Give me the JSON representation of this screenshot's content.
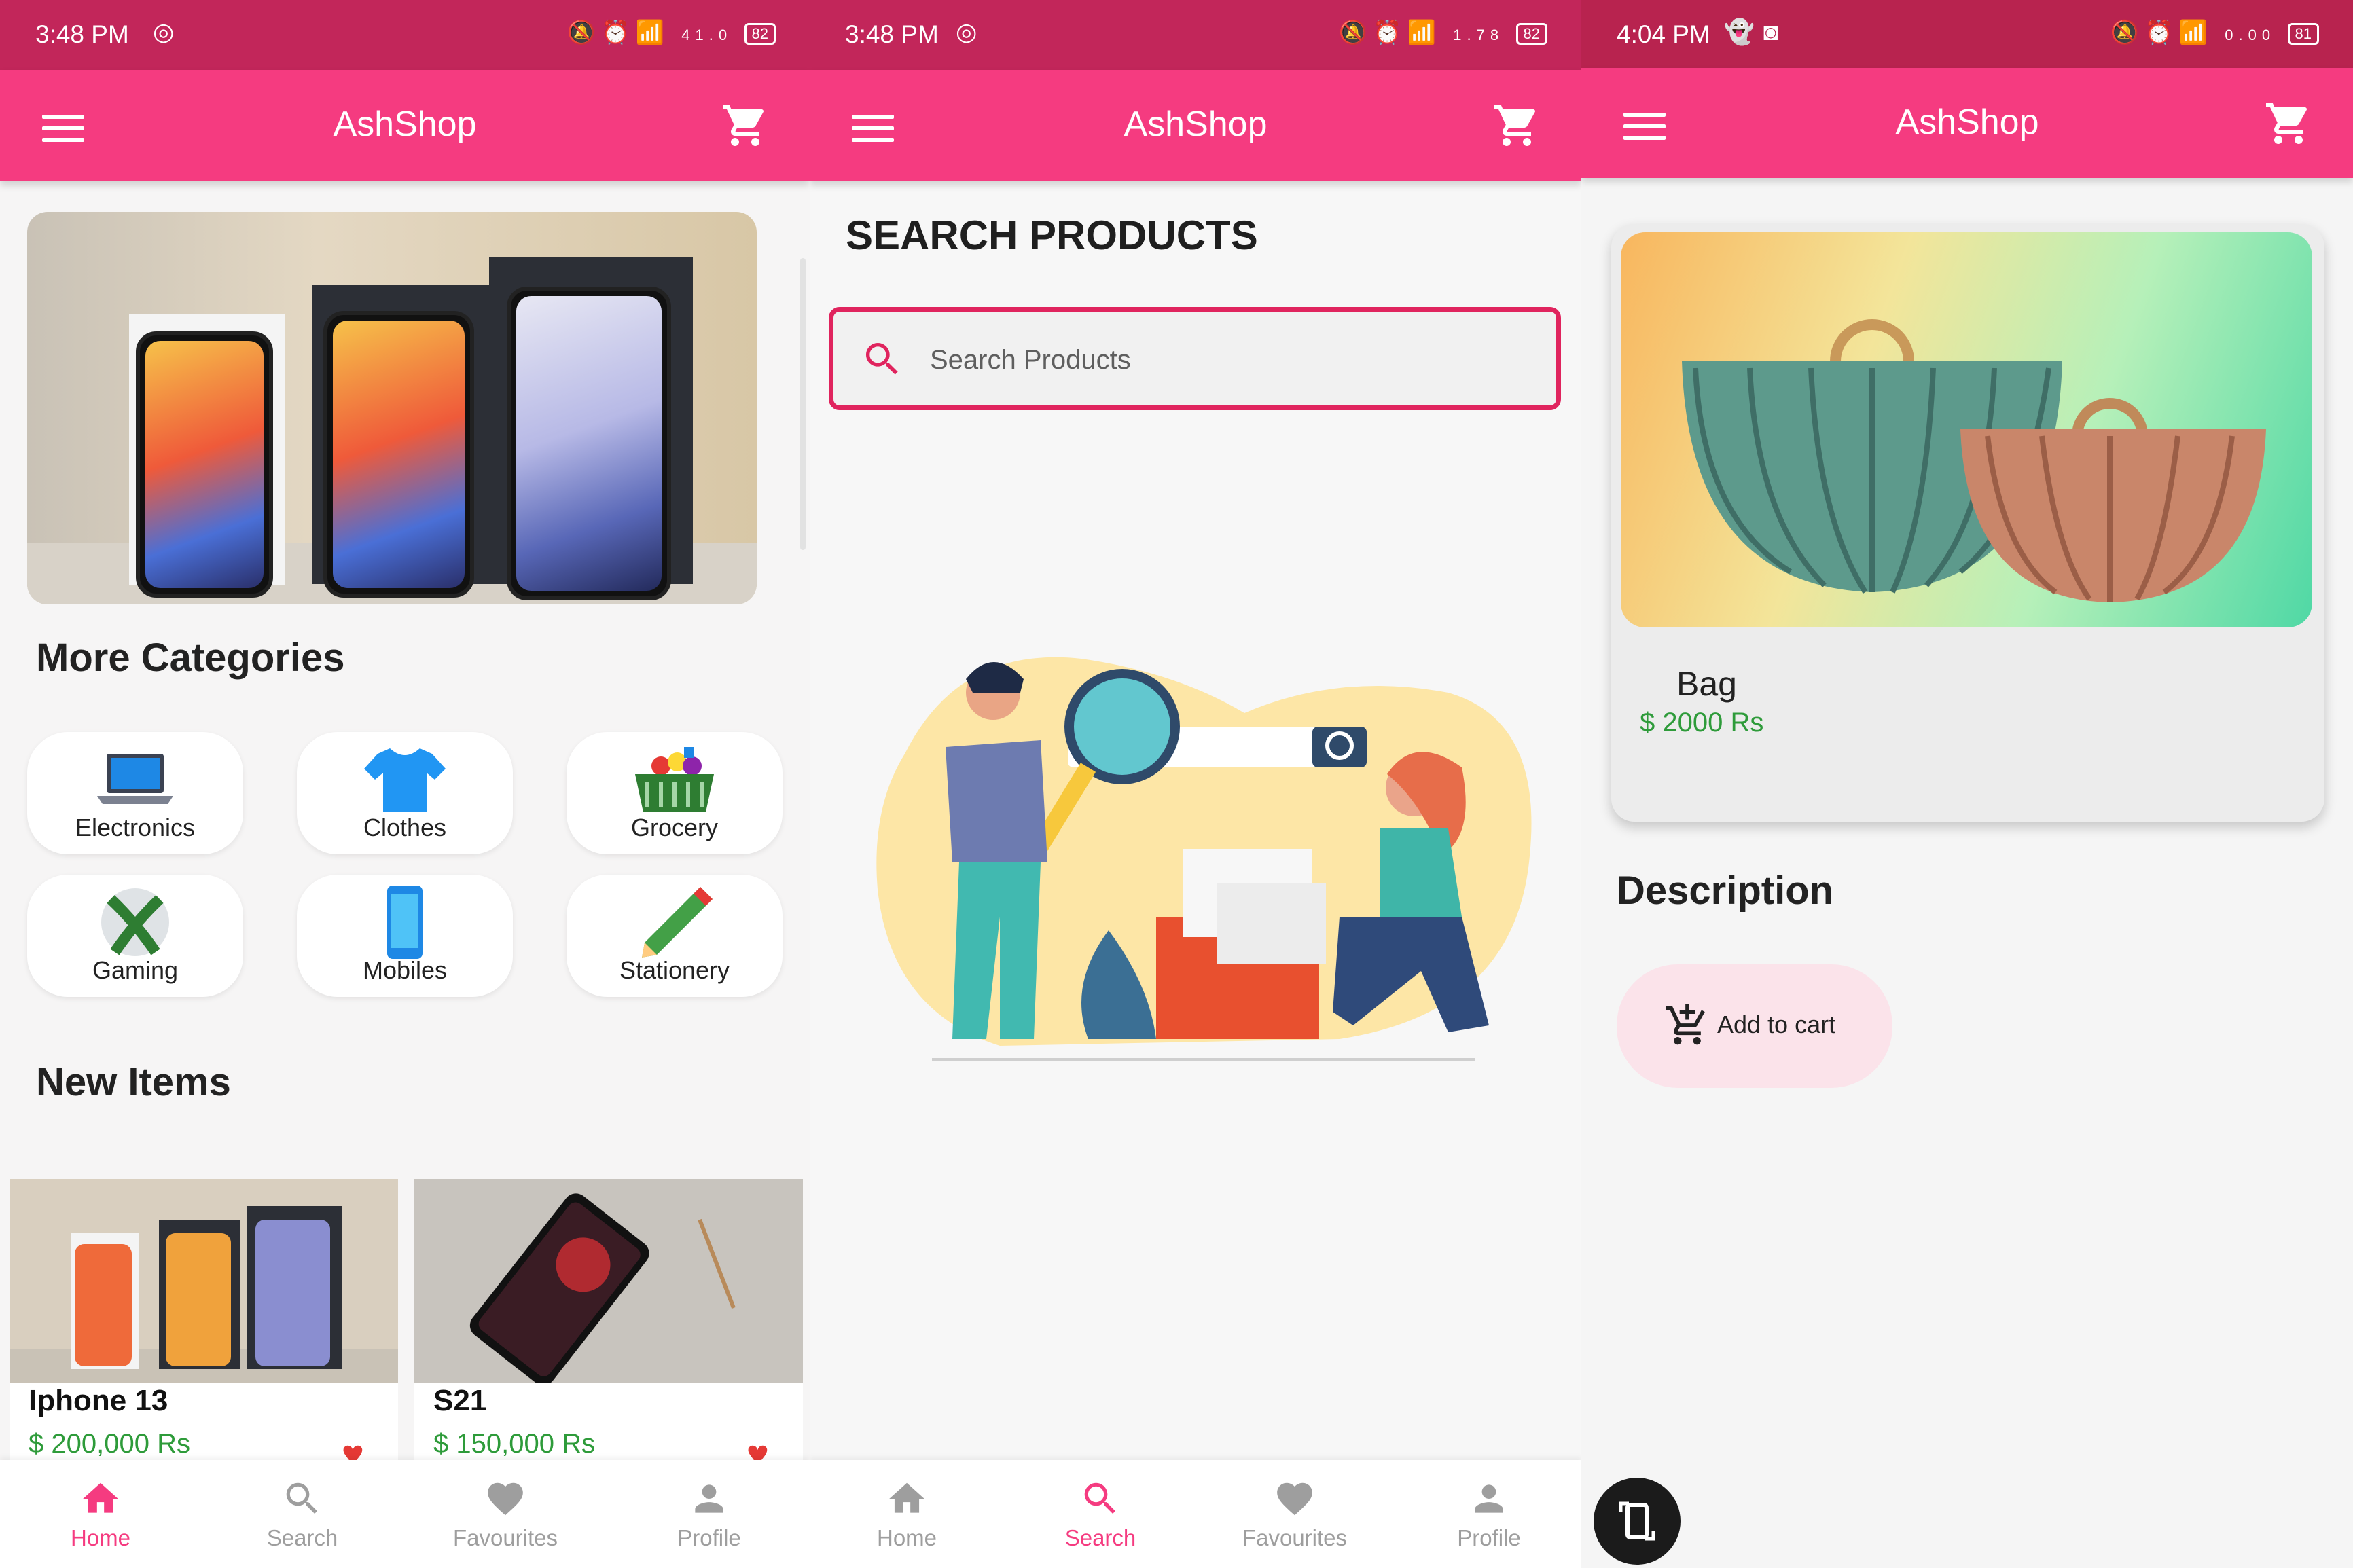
{
  "screens": [
    {
      "status": {
        "time": "3:48 PM",
        "net": "41.0",
        "battery": "82"
      },
      "app_title": "AshShop",
      "categories_heading": "More Categories",
      "categories": [
        {
          "label": "Electronics",
          "icon": "laptop-icon"
        },
        {
          "label": "Clothes",
          "icon": "tshirt-icon"
        },
        {
          "label": "Grocery",
          "icon": "basket-icon"
        },
        {
          "label": "Gaming",
          "icon": "xbox-icon"
        },
        {
          "label": "Mobiles",
          "icon": "phone-icon"
        },
        {
          "label": "Stationery",
          "icon": "pencil-icon"
        }
      ],
      "new_items_heading": "New Items",
      "products": [
        {
          "name": "Iphone 13",
          "price": "200,000 Rs"
        },
        {
          "name": "S21",
          "price": "150,000 Rs"
        }
      ],
      "nav": [
        "Home",
        "Search",
        "Favourites",
        "Profile"
      ],
      "active_nav": "Home"
    },
    {
      "status": {
        "time": "3:48 PM",
        "net": "1.78",
        "battery": "82"
      },
      "app_title": "AshShop",
      "heading": "SEARCH PRODUCTS",
      "search_placeholder": "Search Products",
      "nav": [
        "Home",
        "Search",
        "Favourites",
        "Profile"
      ],
      "active_nav": "Search"
    },
    {
      "status": {
        "time": "4:04 PM",
        "net": "0.00",
        "battery": "81"
      },
      "app_title": "AshShop",
      "product": {
        "name": "Bag",
        "price": "2000 Rs"
      },
      "description_heading": "Description",
      "add_to_cart_label": "Add to cart"
    }
  ],
  "colors": {
    "status_bar": "#c2265a",
    "app_bar": "#f53b80",
    "accent": "#e0245e",
    "price_green": "#2e9b3a"
  }
}
